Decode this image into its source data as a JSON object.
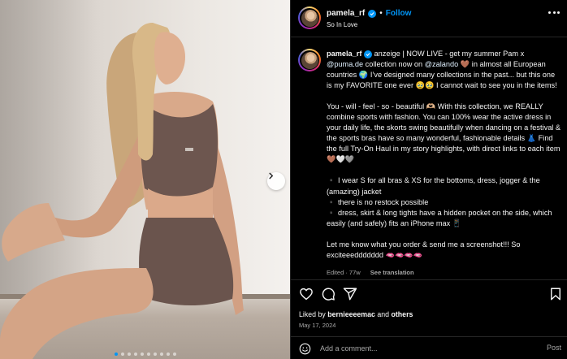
{
  "post": {
    "username": "pamela_rf",
    "follow_label": "Follow",
    "separator": "•",
    "location": "So In Love"
  },
  "caption": {
    "username": "pamela_rf",
    "line1_a": "anzeige | NOW LIVE - get my summer Pam x",
    "mention_puma": "@puma.de",
    "line2_a": "collection now on",
    "mention_zalando": "@zalando",
    "line2_b": "🤎 in almost all European countries 🌍 I’ve designed many collections in the past... but this one is my FAVORITE one ever 🥹🥹 I cannot wait to see you in the items!",
    "para2": "You - will - feel - so - beautiful 🫶🏼 With this collection, we REALLY combine sports with fashion. You can 100% wear the active dress in your daily life, the skorts swing beautifully when dancing on a festival & the sports bras have so many wonderful, fashionable details 👗 Find the full Try-On Haul in my story highlights, with direct links to each item 🤎🤍🩶",
    "bullet1": "▪️ I wear S for all bras & XS for the bottoms, dress, jogger & the (amazing) jacket",
    "bullet2": "▪️ there is no restock possible",
    "bullet3": "▪️ dress, skirt & long tights have a hidden pocket on the side, which easily (and safely) fits an iPhone max 📱",
    "para4": "Let me know what you order & send me a screenshot!!! So exciteeeddddddd 🫦🫦🫦🫦"
  },
  "comment_meta": {
    "edited": "Edited · 77w",
    "see_translation": "See translation"
  },
  "likes": {
    "prefix": "Liked by",
    "user": "bernieeeemac",
    "and": "and",
    "others": "others"
  },
  "date": "May 17, 2024",
  "add_comment": {
    "placeholder": "Add a comment...",
    "post_label": "Post"
  },
  "carousel": {
    "slide_count": 10,
    "active_index": 0
  },
  "colors": {
    "accent": "#0095f6",
    "background": "#000000",
    "muted": "#a8a8a8"
  }
}
